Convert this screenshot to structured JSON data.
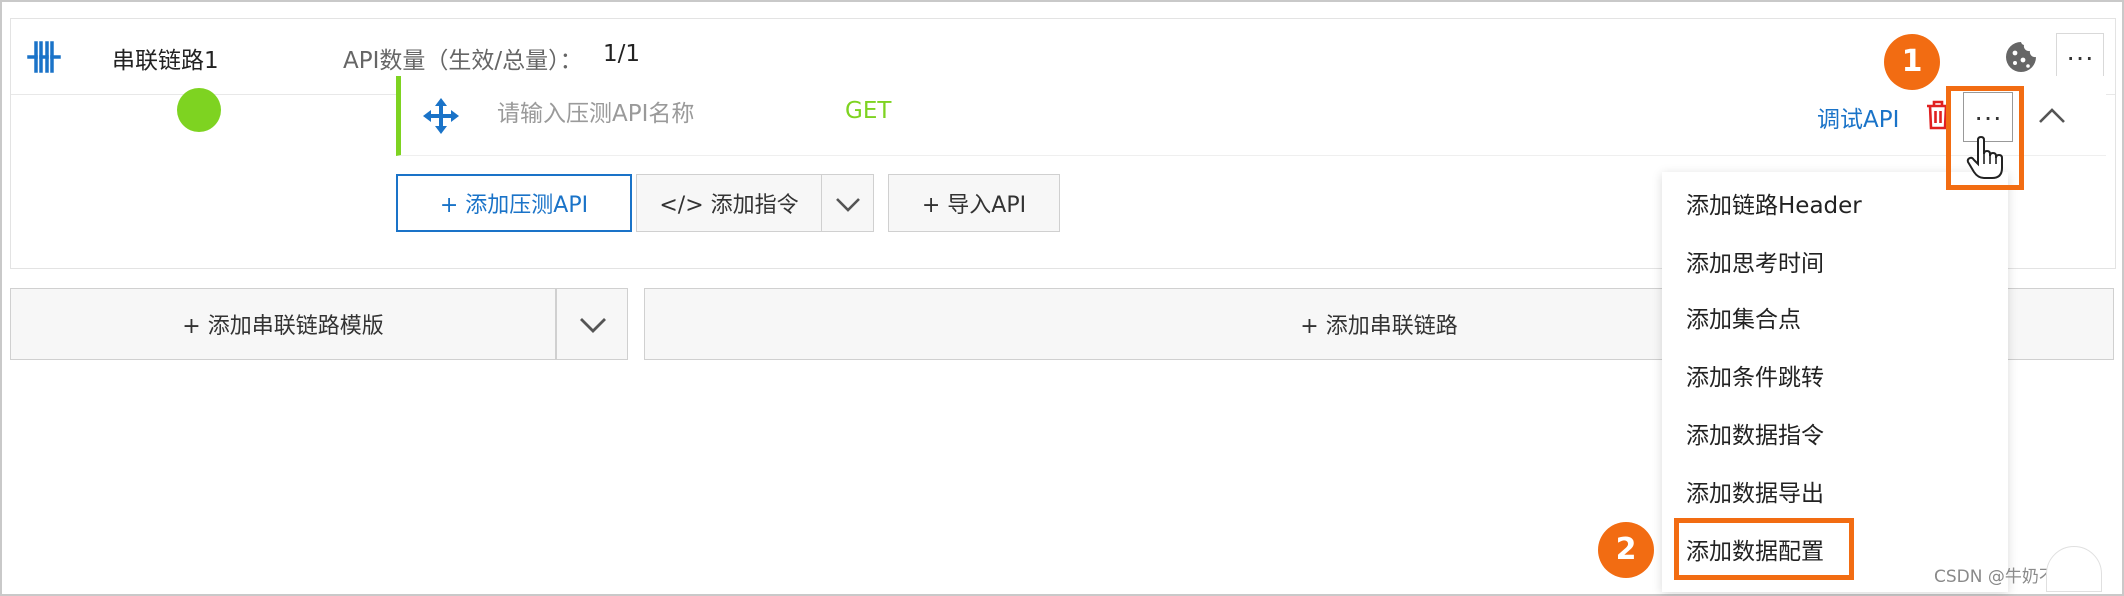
{
  "chain": {
    "name": "串联链路1",
    "api_count_label": "API数量（生效/总量）：",
    "api_count_value": "1/1",
    "more_label": "···"
  },
  "api_row": {
    "name_placeholder": "请输入压测API名称",
    "method": "GET",
    "debug_label": "调试API",
    "more_label": "···"
  },
  "actions": {
    "add_api": "+  添加压测API",
    "add_directive": "</>   添加指令",
    "import_api": "+  导入API"
  },
  "bottom": {
    "add_template": "+ 添加串联链路模版",
    "add_chain": "+ 添加串联链路"
  },
  "menu": {
    "items": [
      {
        "label": "添加链路Header"
      },
      {
        "label": "添加思考时间"
      },
      {
        "label": "添加集合点"
      },
      {
        "label": "添加条件跳转"
      },
      {
        "label": "添加数据指令"
      },
      {
        "label": "添加数据导出"
      },
      {
        "label": "添加数据配置"
      }
    ]
  },
  "annotations": {
    "badge_1": "1",
    "badge_2": "2"
  },
  "watermark": "CSDN @牛奶不面包",
  "colors": {
    "accent_blue": "#1a73c8",
    "success_green": "#7ed321",
    "highlight_orange": "#f26c12",
    "danger_red": "#e02020"
  },
  "icons": [
    "chain-icon",
    "cookie-icon",
    "move-icon",
    "trash-icon",
    "chevron-up-icon",
    "chevron-down-icon",
    "hand-cursor-icon",
    "scroll-top-icon"
  ]
}
